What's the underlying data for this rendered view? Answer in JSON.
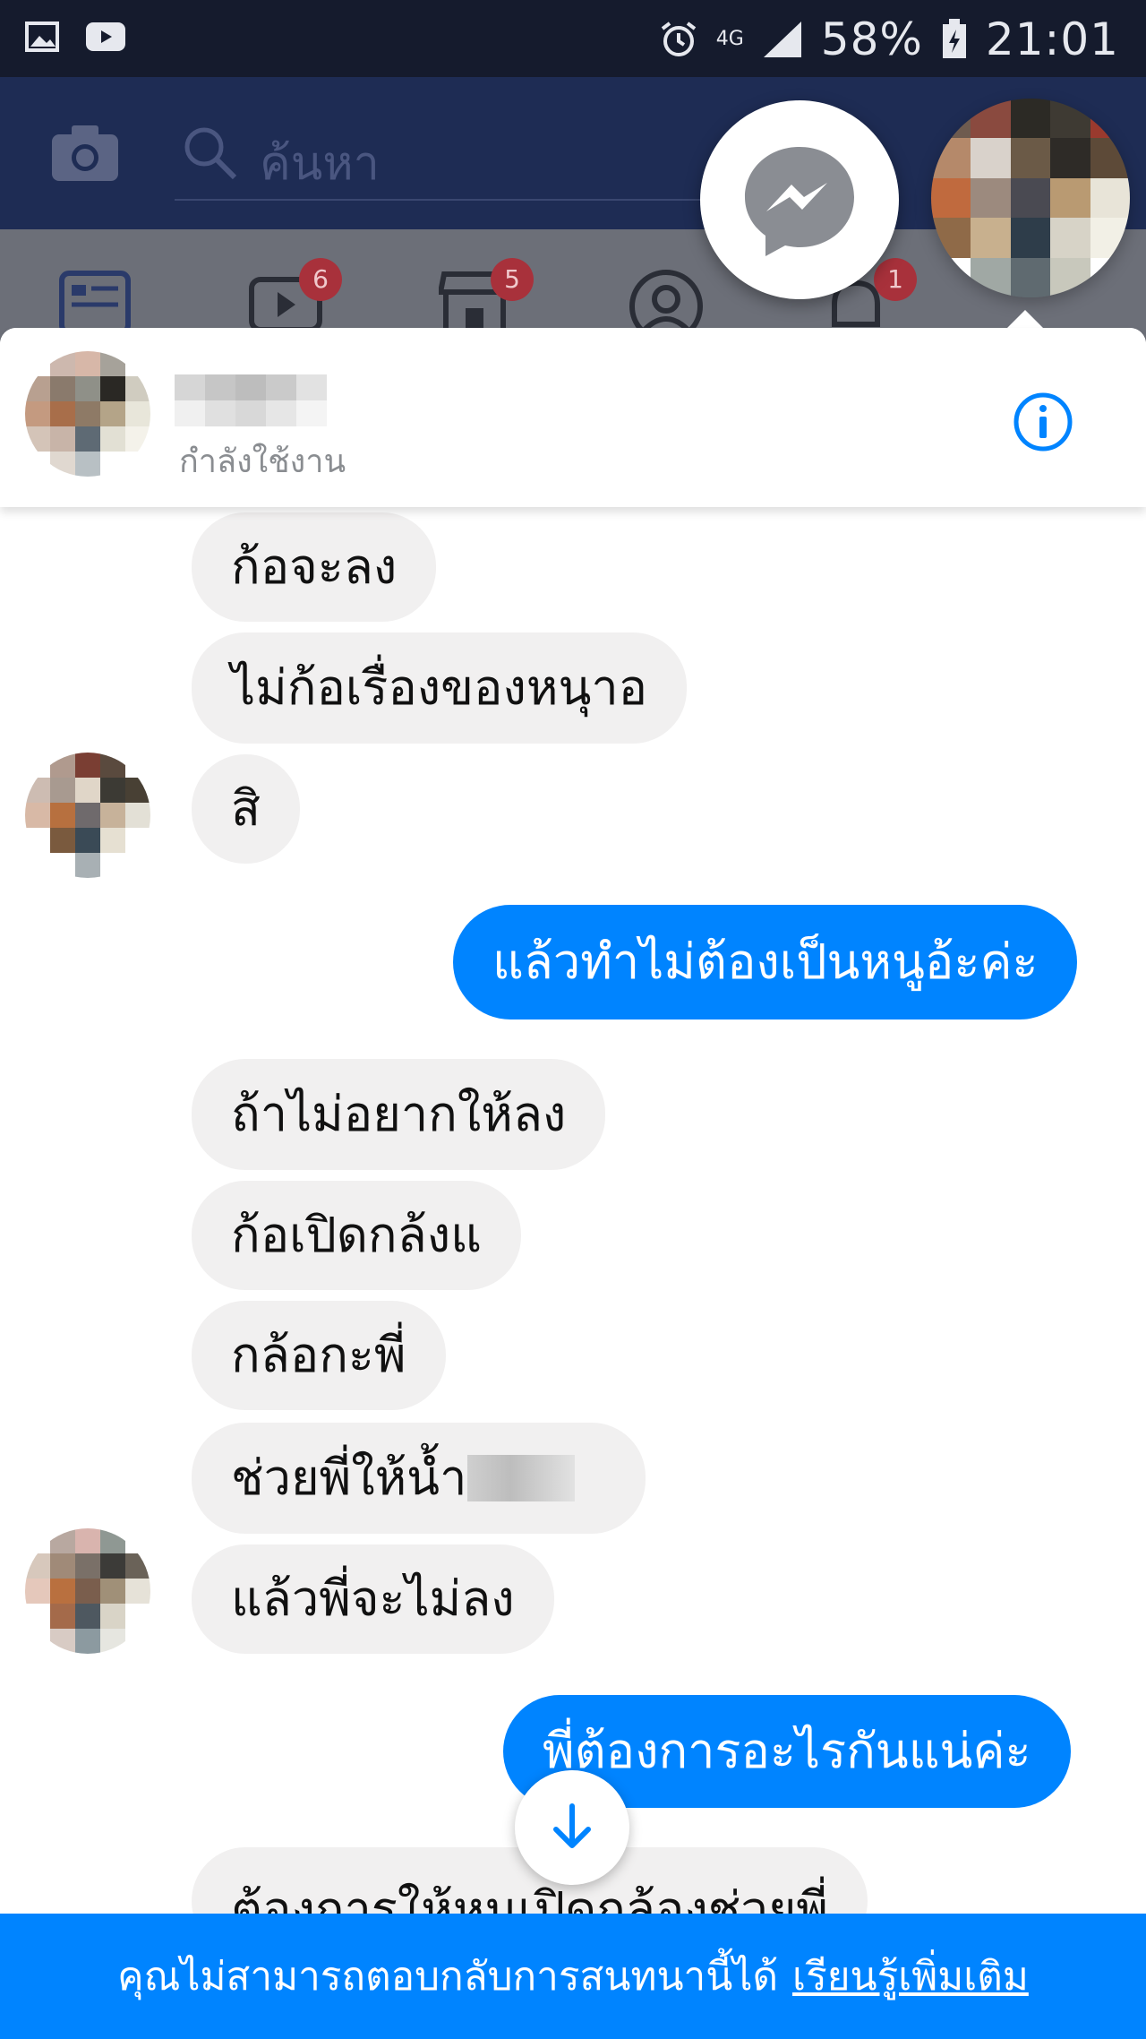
{
  "status_bar": {
    "battery": "58%",
    "time": "21:01",
    "network": "4G",
    "icons": [
      "image-icon",
      "youtube-icon",
      "alarm-icon",
      "signal-icon",
      "battery-icon"
    ]
  },
  "fb_header": {
    "search_placeholder": "ค้นหา",
    "badges": {
      "videos": "6",
      "marketplace": "5",
      "notifications": "1"
    }
  },
  "conversation": {
    "contact_status": "กำลังใช้งาน",
    "messages": [
      {
        "from": "them",
        "text": "ก้อจะลง"
      },
      {
        "from": "them",
        "text": "ไม่ก้อเรื่องของหนุาอ"
      },
      {
        "from": "them",
        "text": "สิ"
      },
      {
        "from": "me",
        "text": "แล้วทำไม่ต้องเป็นหนูอ้ะค่ะ"
      },
      {
        "from": "them",
        "text": "ถ้าไม่อยากให้ลง"
      },
      {
        "from": "them",
        "text": "ก้อเปิดกล้งแ"
      },
      {
        "from": "them",
        "text": "กล้อกะพี่"
      },
      {
        "from": "them",
        "text": "ช่วยพี่ให้น้ำ"
      },
      {
        "from": "them",
        "text": "แล้วพี่จะไม่ลง"
      },
      {
        "from": "me",
        "text": "พี่ต้องการอะไรกันแน่ค่ะ"
      },
      {
        "from": "them",
        "text": "ต้องการให้หนูเปิดกล้องช่วยพี่"
      }
    ]
  },
  "footer": {
    "notice": "คุณไม่สามารถตอบกลับการสนทนานี้ได้",
    "link": "เรียนรู้เพิ่มเติม"
  },
  "colors": {
    "messenger_blue": "#0084ff",
    "incoming_bubble": "#f1f0f0"
  }
}
